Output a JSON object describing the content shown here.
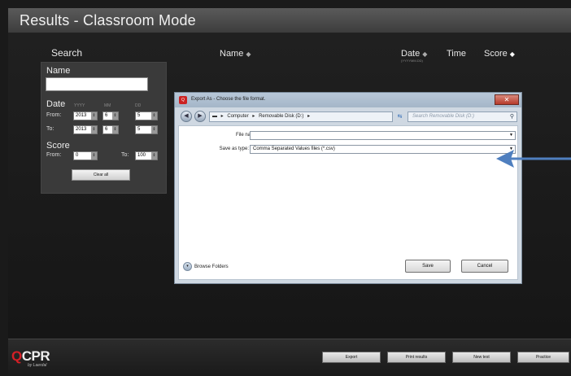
{
  "app": {
    "title": "Results - Classroom Mode"
  },
  "table_header": {
    "search": "Search",
    "name": "Name",
    "date": "Date",
    "date_format": "(YYYYMM.DD)",
    "time": "Time",
    "score": "Score",
    "sort_glyph": "◆"
  },
  "search_panel": {
    "name_label": "Name",
    "name_value": "",
    "date_label": "Date",
    "col_yyyy": "YYYY",
    "col_mm": "MM",
    "col_dd": "DD",
    "from_label": "From:",
    "to_label": "To:",
    "date_from": {
      "yyyy": "2013",
      "mm": "6",
      "dd": "5"
    },
    "date_to": {
      "yyyy": "2013",
      "mm": "6",
      "dd": "5"
    },
    "score_label": "Score",
    "score_from_label": "From:",
    "score_to_label": "To:",
    "score_from": "0",
    "score_to": "100",
    "clear_all": "Clear all"
  },
  "dialog": {
    "title": "Export As - Choose the file format.",
    "close": "✕",
    "path": [
      "Computer",
      "Removable Disk (D:)"
    ],
    "search_placeholder": "Search Removable Disk (D:)",
    "file_name_label": "File name:",
    "file_name_value": "",
    "save_as_type_label": "Save as type:",
    "save_as_type_value": "Comma Separated Values files (*.csv)",
    "browse_folders": "Browse Folders",
    "save": "Save",
    "cancel": "Cancel"
  },
  "annotation": {
    "arrow_color": "#4f7fbf"
  },
  "footer": {
    "logo_main": "CPR",
    "logo_mark": "Q",
    "logo_sub": "by Laerdal",
    "buttons": [
      "Export",
      "Print results",
      "New test",
      "Practice"
    ]
  },
  "colors": {
    "brand_red": "#d61f26",
    "background": "#1a1a1a",
    "panel": "#3a3a3a"
  }
}
